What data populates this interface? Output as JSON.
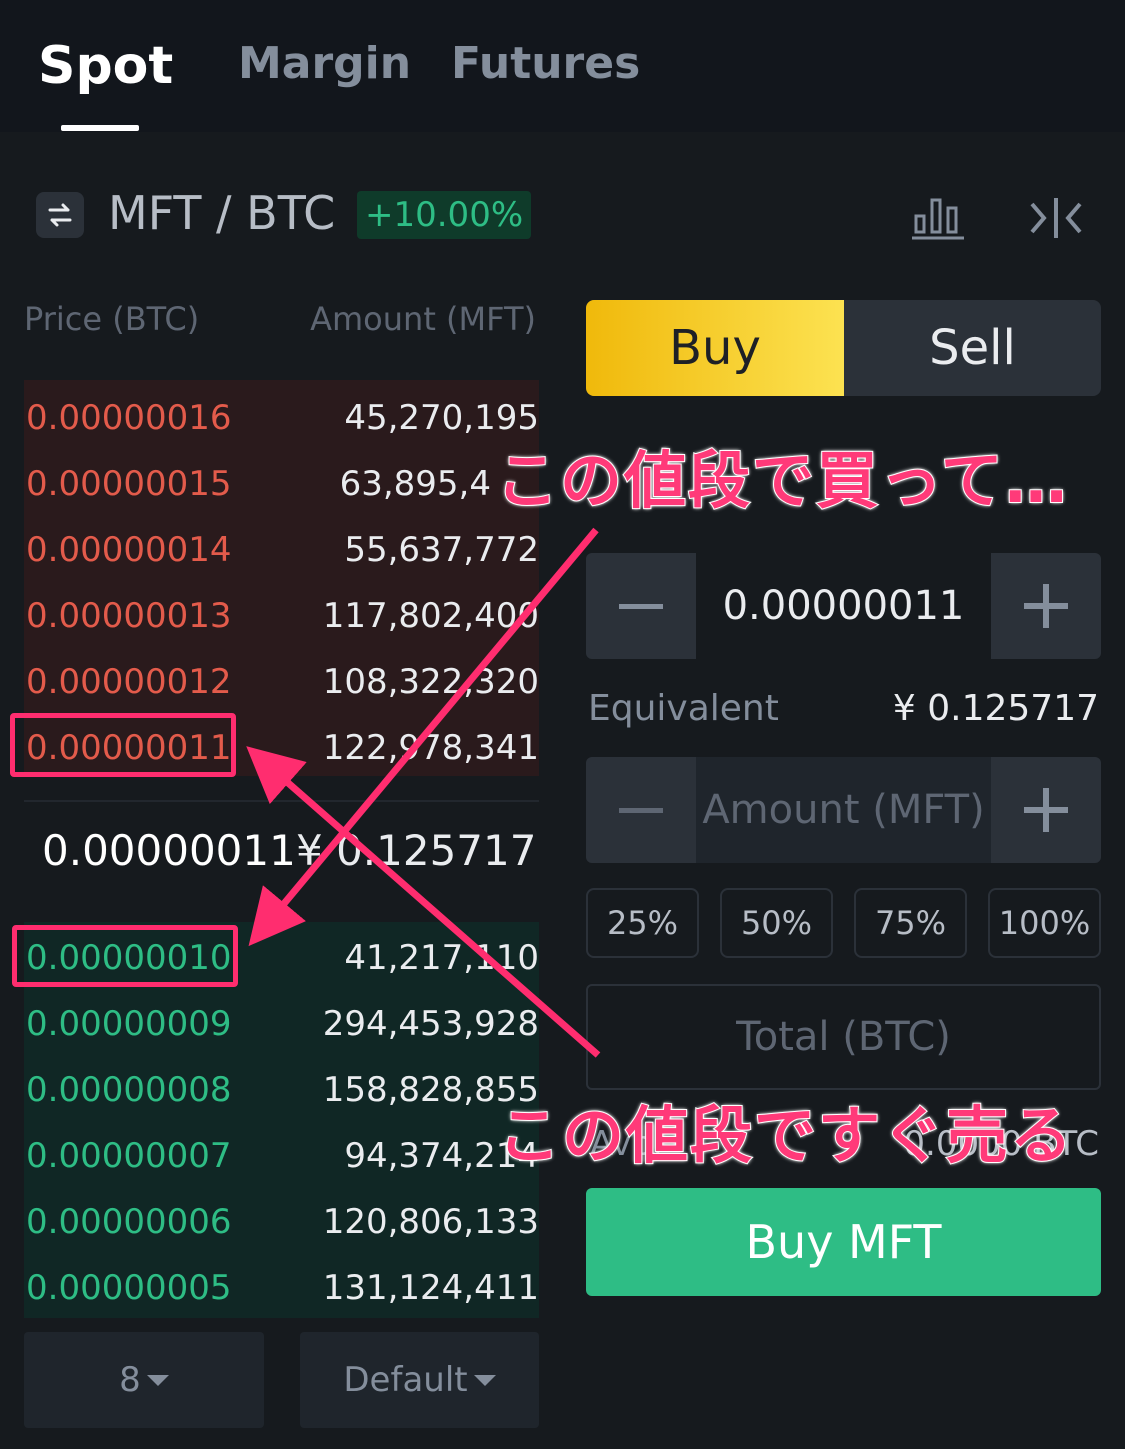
{
  "tabs": [
    {
      "label": "Spot",
      "active": true
    },
    {
      "label": "Margin",
      "active": false
    },
    {
      "label": "Futures",
      "active": false
    }
  ],
  "header": {
    "pair": "MFT / BTC",
    "change": "+10.00%",
    "icons": [
      "swap-icon",
      "chart-icon",
      "collapse-icon"
    ]
  },
  "orderbook": {
    "price_header": "Price (BTC)",
    "amount_header": "Amount (MFT)",
    "asks": [
      {
        "price": "0.00000016",
        "amount": "45,270,195"
      },
      {
        "price": "0.00000015",
        "amount": "63,895,4"
      },
      {
        "price": "0.00000014",
        "amount": "55,637,772"
      },
      {
        "price": "0.00000013",
        "amount": "117,802,400"
      },
      {
        "price": "0.00000012",
        "amount": "108,322,320"
      },
      {
        "price": "0.00000011",
        "amount": "122,978,341"
      }
    ],
    "last_price": "0.00000011",
    "last_fiat": "¥ 0.125717",
    "bids": [
      {
        "price": "0.00000010",
        "amount": "41,217,110"
      },
      {
        "price": "0.00000009",
        "amount": "294,453,928"
      },
      {
        "price": "0.00000008",
        "amount": "158,828,855"
      },
      {
        "price": "0.00000007",
        "amount": "94,374,214"
      },
      {
        "price": "0.00000006",
        "amount": "120,806,133"
      },
      {
        "price": "0.00000005",
        "amount": "131,124,411"
      }
    ],
    "precision": "8",
    "mode": "Default"
  },
  "trade": {
    "buy_label": "Buy",
    "sell_label": "Sell",
    "price_value": "0.00000011",
    "equivalent_label": "Equivalent",
    "equivalent_value": "¥  0.125717",
    "amount_placeholder": "Amount (MFT)",
    "percents": [
      "25%",
      "50%",
      "75%",
      "100%"
    ],
    "total_placeholder": "Total (BTC)",
    "available_label": "Avbl",
    "available_value": "0.0000 BTC",
    "submit_label": "Buy MFT"
  },
  "annotations": {
    "buy_note": "この値段で買って…",
    "sell_note": "この値段ですぐ売る",
    "accent": "#ff2d6f"
  }
}
